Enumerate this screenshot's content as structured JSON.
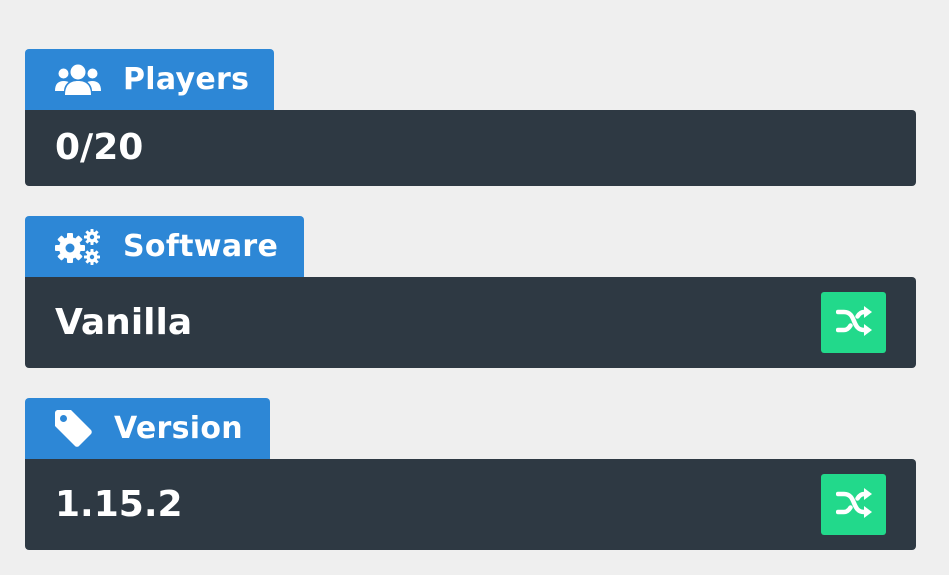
{
  "players": {
    "label": "Players",
    "icon": "users-icon",
    "value": "0/20"
  },
  "software": {
    "label": "Software",
    "icon": "cogs-icon",
    "value": "Vanilla",
    "action_icon": "shuffle-icon"
  },
  "version": {
    "label": "Version",
    "icon": "tag-icon",
    "value": "1.15.2",
    "action_icon": "shuffle-icon"
  },
  "colors": {
    "background": "#efefef",
    "tab": "#2d87d6",
    "box": "#2e3943",
    "action": "#22d98b",
    "text": "#ffffff"
  }
}
